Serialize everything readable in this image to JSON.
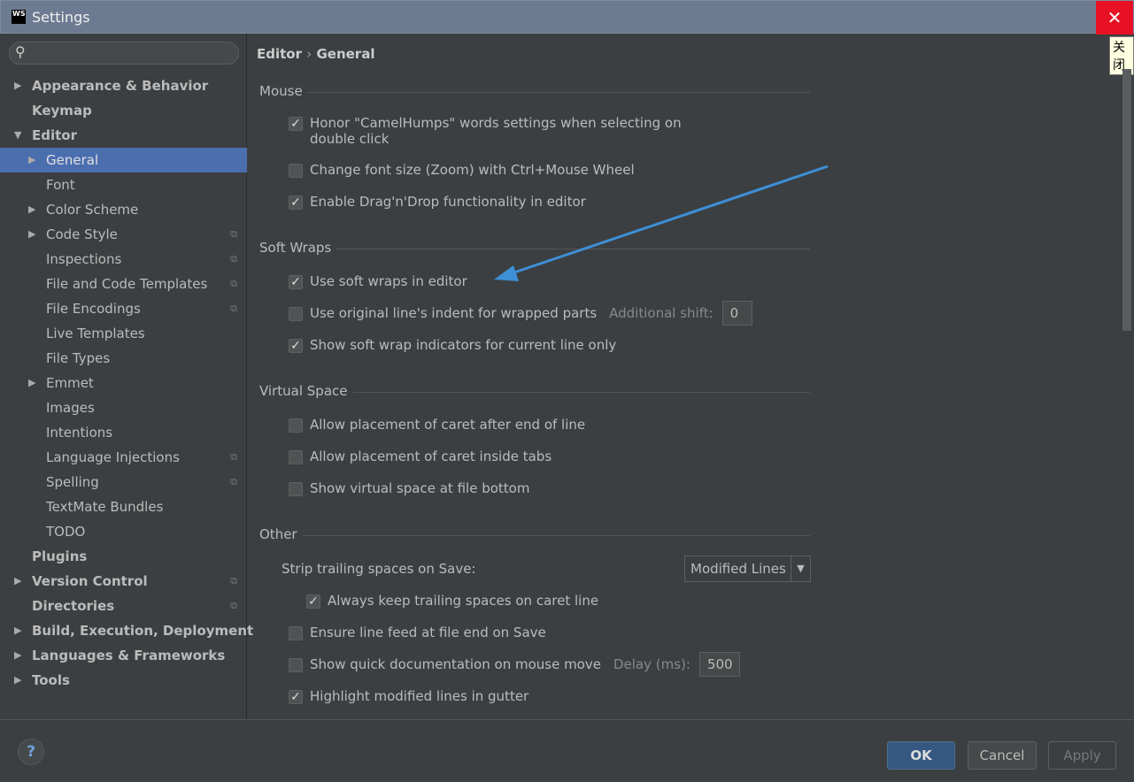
{
  "window": {
    "title": "Settings",
    "logo": "WS",
    "close_icon": "close-icon",
    "close_tooltip": "关闭"
  },
  "sidebar": {
    "search_placeholder": "",
    "items": [
      {
        "label": "Appearance & Behavior",
        "level": 0,
        "bold": true,
        "arrow": "right"
      },
      {
        "label": "Keymap",
        "level": 0,
        "bold": true,
        "arrow": ""
      },
      {
        "label": "Editor",
        "level": 0,
        "bold": true,
        "arrow": "down"
      },
      {
        "label": "General",
        "level": 1,
        "arrow": "right",
        "selected": true
      },
      {
        "label": "Font",
        "level": 1,
        "arrow": ""
      },
      {
        "label": "Color Scheme",
        "level": 1,
        "arrow": "right"
      },
      {
        "label": "Code Style",
        "level": 1,
        "arrow": "right",
        "project": true
      },
      {
        "label": "Inspections",
        "level": 1,
        "arrow": "",
        "project": true
      },
      {
        "label": "File and Code Templates",
        "level": 1,
        "arrow": "",
        "project": true
      },
      {
        "label": "File Encodings",
        "level": 1,
        "arrow": "",
        "project": true
      },
      {
        "label": "Live Templates",
        "level": 1,
        "arrow": ""
      },
      {
        "label": "File Types",
        "level": 1,
        "arrow": ""
      },
      {
        "label": "Emmet",
        "level": 1,
        "arrow": "right"
      },
      {
        "label": "Images",
        "level": 1,
        "arrow": ""
      },
      {
        "label": "Intentions",
        "level": 1,
        "arrow": ""
      },
      {
        "label": "Language Injections",
        "level": 1,
        "arrow": "",
        "project": true
      },
      {
        "label": "Spelling",
        "level": 1,
        "arrow": "",
        "project": true
      },
      {
        "label": "TextMate Bundles",
        "level": 1,
        "arrow": ""
      },
      {
        "label": "TODO",
        "level": 1,
        "arrow": ""
      },
      {
        "label": "Plugins",
        "level": 0,
        "bold": true,
        "arrow": ""
      },
      {
        "label": "Version Control",
        "level": 0,
        "bold": true,
        "arrow": "right",
        "project": true
      },
      {
        "label": "Directories",
        "level": 0,
        "bold": true,
        "arrow": "",
        "project": true
      },
      {
        "label": "Build, Execution, Deployment",
        "level": 0,
        "bold": true,
        "arrow": "right"
      },
      {
        "label": "Languages & Frameworks",
        "level": 0,
        "bold": true,
        "arrow": "right"
      },
      {
        "label": "Tools",
        "level": 0,
        "bold": true,
        "arrow": "right"
      }
    ]
  },
  "breadcrumb": {
    "parent": "Editor",
    "sep": "›",
    "current": "General"
  },
  "sections": {
    "mouse": "Mouse",
    "soft_wraps": "Soft Wraps",
    "virtual_space": "Virtual Space",
    "other": "Other"
  },
  "options": {
    "camelhumps": {
      "label": "Honor \"CamelHumps\" words settings when selecting on",
      "label2": "double click",
      "checked": true
    },
    "zoom": {
      "label": "Change font size (Zoom) with Ctrl+Mouse Wheel",
      "checked": false
    },
    "dnd": {
      "label": "Enable Drag'n'Drop functionality in editor",
      "checked": true
    },
    "soft_wraps": {
      "label": "Use soft wraps in editor",
      "checked": true
    },
    "orig_indent": {
      "label": "Use original line's indent for wrapped parts",
      "checked": false,
      "hint": "Additional shift:",
      "value": "0"
    },
    "wrap_ind": {
      "label": "Show soft wrap indicators for current line only",
      "checked": true
    },
    "caret_eol": {
      "label": "Allow placement of caret after end of line",
      "checked": false
    },
    "caret_tabs": {
      "label": "Allow placement of caret inside tabs",
      "checked": false
    },
    "virt_bottom": {
      "label": "Show virtual space at file bottom",
      "checked": false
    },
    "strip_label": "Strip trailing spaces on Save:",
    "strip_value": "Modified Lines",
    "keep_trailing": {
      "label": "Always keep trailing spaces on caret line",
      "checked": true
    },
    "line_feed": {
      "label": "Ensure line feed at file end on Save",
      "checked": false
    },
    "quick_doc": {
      "label": "Show quick documentation on mouse move",
      "checked": false,
      "hint": "Delay (ms):",
      "value": "500"
    },
    "highlight": {
      "label": "Highlight modified lines in gutter",
      "checked": true
    }
  },
  "annotation": {
    "arrow_color": "#3d8fd6"
  },
  "footer": {
    "help": "?",
    "ok": "OK",
    "cancel": "Cancel",
    "apply": "Apply"
  }
}
